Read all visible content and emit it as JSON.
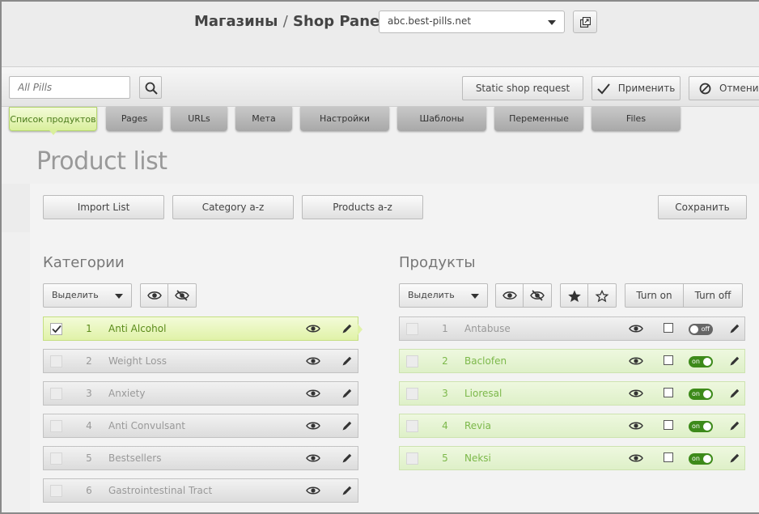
{
  "header": {
    "breadcrumb_shops": "Магазины",
    "separator": "/",
    "breadcrumb_panel": "Shop Panel",
    "shop_selected": "abc.best-pills.net"
  },
  "toolbar": {
    "search_placeholder": "All Pills",
    "static_request_label": "Static shop request",
    "apply_label": "Применить",
    "cancel_label": "Отмени"
  },
  "tabs": [
    {
      "label": "Список продуктов",
      "active": true
    },
    {
      "label": "Pages"
    },
    {
      "label": "URLs"
    },
    {
      "label": "Мета"
    },
    {
      "label": "Настройки"
    },
    {
      "label": "Шаблоны"
    },
    {
      "label": "Переменные"
    },
    {
      "label": "Files"
    }
  ],
  "main": {
    "title": "Product list",
    "import_label": "Import List",
    "category_sort_label": "Category a-z",
    "product_sort_label": "Products a-z",
    "save_label": "Сохранить"
  },
  "categories": {
    "title": "Категории",
    "select_label": "Выделить",
    "items": [
      {
        "num": "1",
        "name": "Anti Alcohol",
        "selected": true
      },
      {
        "num": "2",
        "name": "Weight Loss"
      },
      {
        "num": "3",
        "name": "Anxiety"
      },
      {
        "num": "4",
        "name": "Anti Convulsant"
      },
      {
        "num": "5",
        "name": "Bestsellers"
      },
      {
        "num": "6",
        "name": "Gastrointestinal Tract"
      }
    ]
  },
  "products": {
    "title": "Продукты",
    "select_label": "Выделить",
    "turn_on_label": "Turn on",
    "turn_off_label": "Turn off",
    "items": [
      {
        "num": "1",
        "name": "Antabuse",
        "state": "off"
      },
      {
        "num": "2",
        "name": "Baclofen",
        "state": "on"
      },
      {
        "num": "3",
        "name": "Lioresal",
        "state": "on"
      },
      {
        "num": "4",
        "name": "Revia",
        "state": "on"
      },
      {
        "num": "5",
        "name": "Neksi",
        "state": "on"
      }
    ]
  }
}
